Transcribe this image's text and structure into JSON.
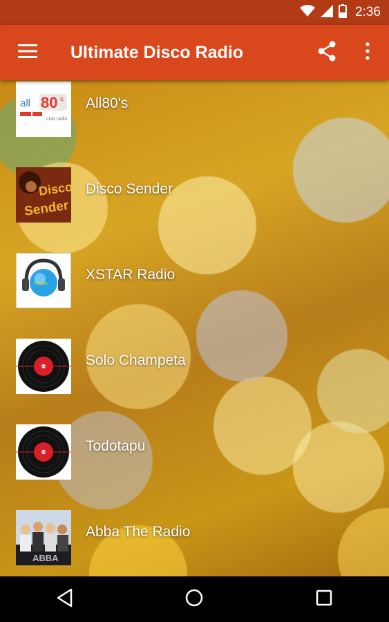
{
  "status_bar": {
    "time": "2:36",
    "icons": [
      "wifi-icon",
      "signal-icon",
      "battery-icon"
    ]
  },
  "app_bar": {
    "title": "Ultimate Disco Radio",
    "menu_icon": "hamburger-menu-icon",
    "share_icon": "share-icon",
    "overflow_icon": "more-vert-icon",
    "color": "#d9471c"
  },
  "stations": [
    {
      "name": "All80's",
      "logo": "all80s-logo"
    },
    {
      "name": "Disco Sender",
      "logo": "disco-sender-logo"
    },
    {
      "name": "XSTAR Radio",
      "logo": "xstar-radio-logo"
    },
    {
      "name": "Solo Champeta",
      "logo": "vinyl-record-icon"
    },
    {
      "name": "Todotapu",
      "logo": "vinyl-record-icon"
    },
    {
      "name": "Abba The Radio",
      "logo": "abba-photo"
    }
  ],
  "nav_bar": {
    "back_icon": "back-icon",
    "home_icon": "home-icon",
    "recents_icon": "recents-icon"
  }
}
